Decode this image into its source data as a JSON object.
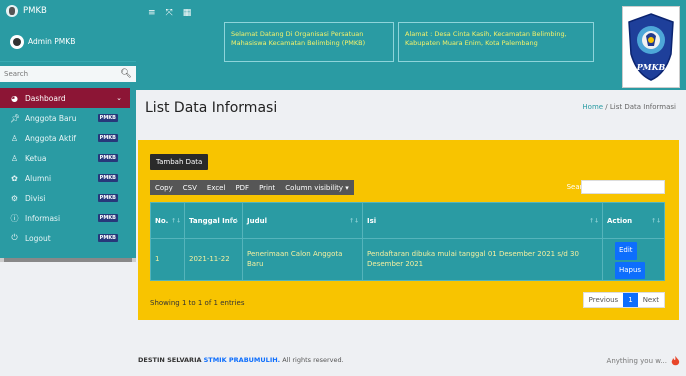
{
  "sidebar": {
    "brand": "PMKB",
    "user": "Admin PMKB",
    "search_placeholder": "Search",
    "items": [
      {
        "label": "Dashboard",
        "icon": "▣"
      },
      {
        "label": "Anggota Baru",
        "icon": "♦",
        "badge": "PMKB"
      },
      {
        "label": "Anggota Aktif",
        "icon": "♦",
        "badge": "PMKB"
      },
      {
        "label": "Ketua",
        "icon": "♦",
        "badge": "PMKB"
      },
      {
        "label": "Alumni",
        "icon": "✿",
        "badge": "PMKB"
      },
      {
        "label": "Divisi",
        "icon": "◉",
        "badge": "PMKB"
      },
      {
        "label": "Informasi",
        "icon": "●",
        "badge": "PMKB"
      },
      {
        "label": "Logout",
        "icon": "⏻",
        "badge": "PMKB"
      }
    ]
  },
  "header": {
    "info_left": "Selamat Datang Di Organisasi Persatuan Mahasiswa Kecamatan Belimbing (PMKB)",
    "info_right": "Alamat : Desa Cinta Kasih, Kecamatan Belimbing, Kabupaten Muara Enim, Kota Palembang",
    "logo_text": "PMKB"
  },
  "page": {
    "title": "List Data Informasi",
    "breadcrumb_home": "Home",
    "breadcrumb_sep": " / ",
    "breadcrumb_current": "List Data Informasi"
  },
  "panel": {
    "add_button": "Tambah Data",
    "tools": [
      "Copy",
      "CSV",
      "Excel",
      "PDF",
      "Print",
      "Column visibility ▾"
    ],
    "search_label": "Search:",
    "columns": [
      "No.",
      "Tanggal Info",
      "Judul",
      "Isi",
      "Action"
    ],
    "rows": [
      {
        "no": "1",
        "tanggal": "2021-11-22",
        "judul": "Penerimaan Calon Anggota Baru",
        "isi": "Pendaftaran dibuka mulai tanggal 01 Desember 2021 s/d 30 Desember 2021"
      }
    ],
    "edit": "Edit",
    "hapus": "Hapus",
    "entries": "Showing 1 to 1 of 1 entries",
    "prev": "Previous",
    "page": "1",
    "next": "Next"
  },
  "footer": {
    "name": "DESTIN SELVARIA",
    "school": "STMIK PRABUMULIH.",
    "rights": " All rights reserved.",
    "right_text": "Anything you w..."
  },
  "colors": {
    "teal": "#2a9ba3",
    "active": "#8c1535",
    "panel": "#f8c400",
    "highlight": "#f4f26a"
  }
}
